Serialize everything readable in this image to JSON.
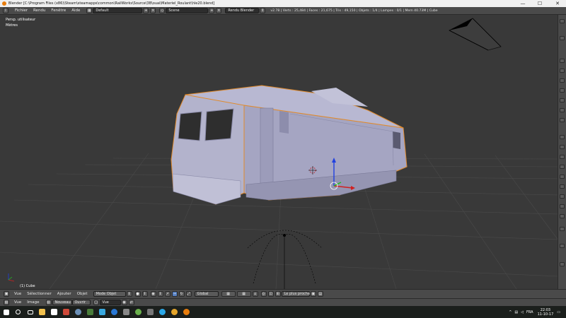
{
  "window": {
    "title": "Blender [C:\\Program Files (x86)\\Steam\\steamapps\\common\\RailWorks\\Source\\3B\\ouai\\Materiel_Roulant\\hle20.blend]",
    "icon": "blender-icon"
  },
  "info_header": {
    "menus": [
      "Fichier",
      "Rendu",
      "Fenêtre",
      "Aide"
    ],
    "layout": "Default",
    "scene": "Scene",
    "engine": "Rendu Blender",
    "stats": "v2.78 | Verts : 25,484 | Faces : 21,675 | Tris : 49,150 | Objets : 1/4 | Lampes : 0/1 | Mem 40.73M | Cube"
  },
  "viewport": {
    "view_label": "Persp. utilisateur",
    "units_label": "Mètres",
    "object_label": "(1) Cube"
  },
  "view3d_header": {
    "menus": [
      "Vue",
      "Sélectionner",
      "Ajouter",
      "Objet"
    ],
    "mode": "Mode Objet",
    "orientation": "Global",
    "snap": "Le plus proche"
  },
  "image_header": {
    "menus": [
      "Vue",
      "Image"
    ],
    "new_label": "Nouveau",
    "open_label": "Ouvrir",
    "view_label": "Vue"
  },
  "taskbar": {
    "language": "FRA",
    "time": "22:03",
    "date": "11-10-17"
  },
  "colors": {
    "background": "#393939",
    "model": "#a8a8c4",
    "selection": "#e08a2c",
    "axis_x": "#d02020",
    "axis_y": "#20c020",
    "axis_z": "#2040e0"
  }
}
